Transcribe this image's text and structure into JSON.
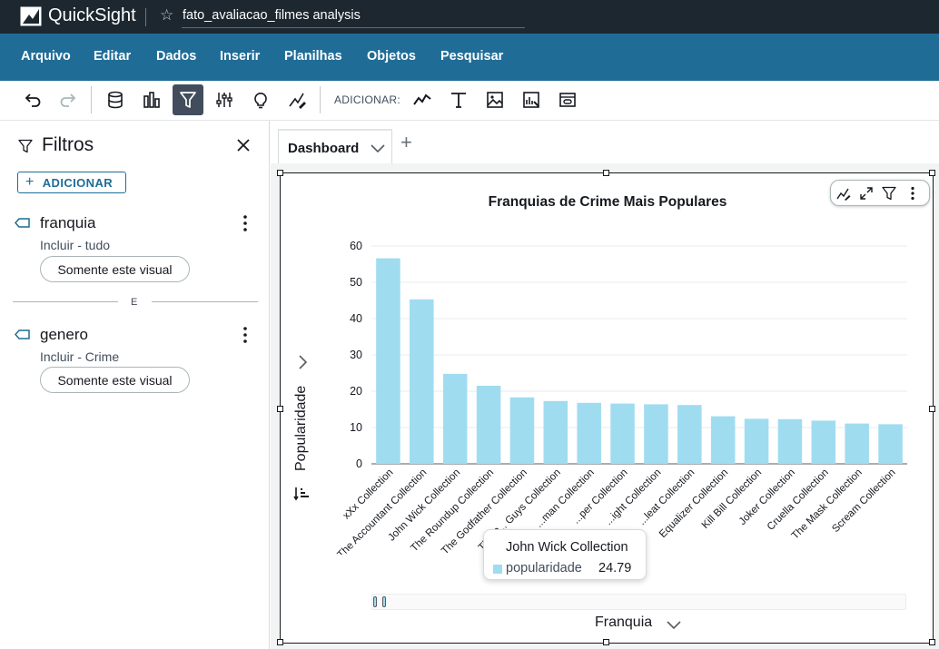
{
  "app": {
    "brand": "QuickSight",
    "document_title": "fato_avaliacao_filmes analysis"
  },
  "menu": {
    "items": [
      "Arquivo",
      "Editar",
      "Dados",
      "Inserir",
      "Planilhas",
      "Objetos",
      "Pesquisar"
    ]
  },
  "toolbar": {
    "add_label": "ADICIONAR:",
    "active_tool": "filter",
    "icons": [
      "undo-icon",
      "redo-icon",
      "dataset-icon",
      "visualize-icon",
      "filter-icon",
      "parameters-icon",
      "insights-icon",
      "themes-icon",
      "add-visual-icon",
      "add-text-icon",
      "add-image-icon",
      "add-insight-icon",
      "add-embed-icon"
    ]
  },
  "sidebar": {
    "title": "Filtros",
    "add_button": "ADICIONAR",
    "filters": [
      {
        "name": "franquia",
        "description": "Incluir - tudo",
        "scope": "Somente este visual"
      },
      {
        "name": "genero",
        "description": "Incluir - Crime",
        "scope": "Somente este visual"
      }
    ],
    "divider_label": "E"
  },
  "tabs": {
    "items": [
      {
        "label": "Dashboard"
      }
    ],
    "add_icon": "plus-icon"
  },
  "visual": {
    "y_axis_title": "Popularidade",
    "x_axis_title": "Franquia",
    "tooltip": {
      "title": "John Wick Collection",
      "measure": "popularidade",
      "value": "24.79"
    },
    "scroll_range": [
      0.0,
      0.03
    ]
  },
  "chart_data": {
    "type": "bar",
    "title": "Franquias de Crime Mais Populares",
    "xlabel": "Franquia",
    "ylabel": "Popularidade",
    "ylim": [
      0,
      60
    ],
    "yticks": [
      0,
      10,
      20,
      30,
      40,
      50,
      60
    ],
    "grid": true,
    "color": "#a0dcf0",
    "categories": [
      "xXx Collection",
      "The Accountant Collection",
      "John Wick Collection",
      "The Roundup Collection",
      "The Godfather Collection",
      "The P... Guys Collection",
      "...man Collection",
      "...per Collection",
      "...ight Collection",
      "...leat Collection",
      "Equalizer Collection",
      "Kill Bill Collection",
      "Joker Collection",
      "Cruella Collection",
      "The Mask Collection",
      "Scream Collection"
    ],
    "values": [
      56.6,
      45.3,
      24.79,
      21.5,
      18.3,
      17.3,
      16.8,
      16.6,
      16.4,
      16.2,
      13.1,
      12.4,
      12.3,
      11.9,
      11.1,
      10.9
    ]
  }
}
